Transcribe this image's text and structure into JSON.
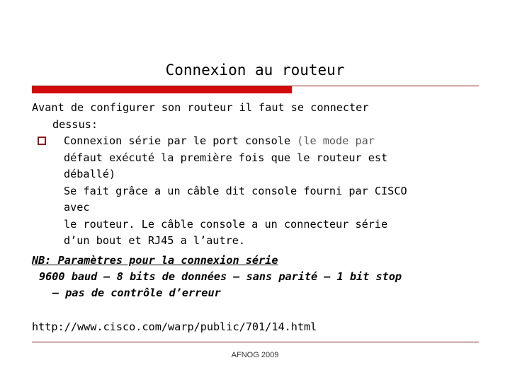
{
  "slide": {
    "title": "Connexion au routeur",
    "theme": {
      "accent_bar": "#d10b0b",
      "accent_rule": "#8f1010",
      "bullet_color": "#8c1b1b",
      "footer_rule": "#6e1414",
      "text": "#000000",
      "dim_text": "#595959",
      "background": "#ffffff"
    },
    "intro": {
      "line1": "Avant de configurer son routeur il faut se connecter",
      "line2": "dessus:"
    },
    "bullet": {
      "marker": "square-outline-bullet",
      "text_main": "Connexion série par le port console ",
      "text_dim": "(le mode par",
      "line2": "défaut exécuté la première fois que le routeur est",
      "line3": "déballé)"
    },
    "sub_paragraphs": [
      "Se fait grâce a un câble dit console fourni par CISCO",
      "avec",
      "le routeur. Le câble console a un connecteur série",
      "d’un bout et RJ45 a l’autre."
    ],
    "note": {
      "heading": "NB: Paramètres pour la connexion série",
      "params_line1": "9600 baud – 8 bits de données – sans parité – 1 bit stop",
      "params_line2": "– pas de contrôle d’erreur"
    },
    "url": "http://www.cisco.com/warp/public/701/14.html",
    "footer": {
      "text": "AFNOG 2009"
    }
  }
}
